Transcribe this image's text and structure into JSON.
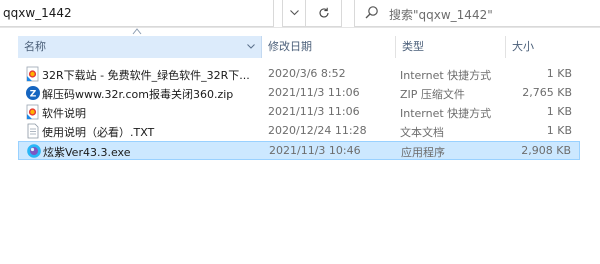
{
  "address": {
    "path": "qqxw_1442"
  },
  "search": {
    "placeholder": "搜索\"qqxw_1442\""
  },
  "columns": {
    "name": "名称",
    "date": "修改日期",
    "type": "类型",
    "size": "大小"
  },
  "files": [
    {
      "name": "32R下载站 - 免费软件_绿色软件_32R下...",
      "date": "2020/3/6 8:52",
      "type": "Internet 快捷方式",
      "size": "1 KB",
      "icon": "internet-shortcut-icon"
    },
    {
      "name": "解压码www.32r.com报毒关闭360.zip",
      "date": "2021/11/3 11:06",
      "type": "ZIP 压缩文件",
      "size": "2,765 KB",
      "icon": "zip-archive-icon"
    },
    {
      "name": "软件说明",
      "date": "2021/11/3 11:06",
      "type": "Internet 快捷方式",
      "size": "1 KB",
      "icon": "internet-shortcut-icon"
    },
    {
      "name": "使用说明（必看）.TXT",
      "date": "2020/12/24 11:28",
      "type": "文本文档",
      "size": "1 KB",
      "icon": "text-document-icon"
    },
    {
      "name": "炫紫Ver43.3.exe",
      "date": "2021/11/3 10:46",
      "type": "应用程序",
      "size": "2,908 KB",
      "icon": "application-icon",
      "selected": true
    }
  ],
  "colors": {
    "selected_bg": "#cce8ff",
    "selected_border": "#99d1ff",
    "header_hover": "#dcebfb",
    "header_text": "#4c607a"
  }
}
